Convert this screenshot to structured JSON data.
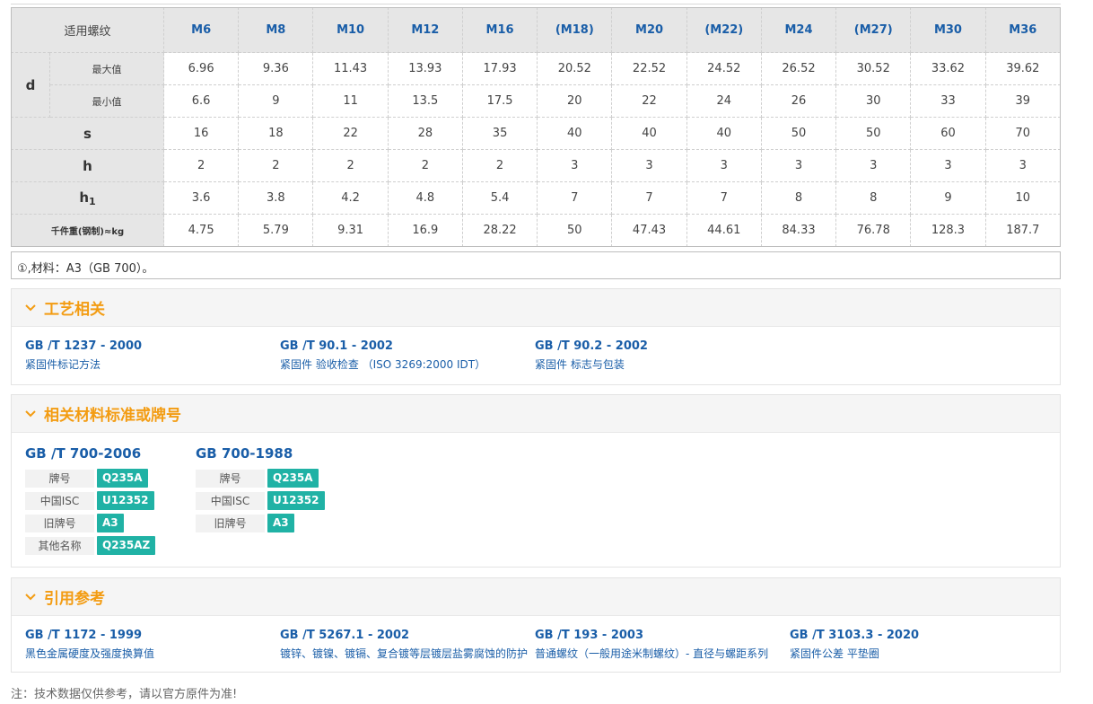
{
  "table": {
    "corner": "适用螺纹",
    "sizes": [
      "M6",
      "M8",
      "M10",
      "M12",
      "M16",
      "(M18)",
      "M20",
      "(M22)",
      "M24",
      "(M27)",
      "M30",
      "M36"
    ],
    "d_label": "d",
    "d_max_label": "最大值",
    "d_min_label": "最小值",
    "d_max": [
      "6.96",
      "9.36",
      "11.43",
      "13.93",
      "17.93",
      "20.52",
      "22.52",
      "24.52",
      "26.52",
      "30.52",
      "33.62",
      "39.62"
    ],
    "d_min": [
      "6.6",
      "9",
      "11",
      "13.5",
      "17.5",
      "20",
      "22",
      "24",
      "26",
      "30",
      "33",
      "39"
    ],
    "s_label": "s",
    "s": [
      "16",
      "18",
      "22",
      "28",
      "35",
      "40",
      "40",
      "40",
      "50",
      "50",
      "60",
      "70"
    ],
    "h_label": "h",
    "h": [
      "2",
      "2",
      "2",
      "2",
      "2",
      "3",
      "3",
      "3",
      "3",
      "3",
      "3",
      "3"
    ],
    "h1_label": "h",
    "h1_sub": "1",
    "h1": [
      "3.6",
      "3.8",
      "4.2",
      "4.8",
      "5.4",
      "7",
      "7",
      "7",
      "8",
      "8",
      "9",
      "10"
    ],
    "weight_label": "千件重(钢制)≈kg",
    "weight": [
      "4.75",
      "5.79",
      "9.31",
      "16.9",
      "28.22",
      "50",
      "47.43",
      "44.61",
      "84.33",
      "76.78",
      "128.3",
      "187.7"
    ]
  },
  "note": "①,材料：A3（GB 700）。",
  "process": {
    "title": "工艺相关",
    "items": [
      {
        "code": "GB /T 1237 - 2000",
        "desc": "紧固件标记方法"
      },
      {
        "code": "GB /T 90.1 - 2002",
        "desc": "紧固件 验收检查 （ISO 3269:2000 IDT）"
      },
      {
        "code": "GB /T 90.2 - 2002",
        "desc": "紧固件 标志与包装"
      }
    ]
  },
  "materials": {
    "title": "相关材料标准或牌号",
    "groups": [
      {
        "title": "GB /T 700-2006",
        "rows": [
          {
            "key": "牌号",
            "value": "Q235A"
          },
          {
            "key": "中国ISC",
            "value": "U12352"
          },
          {
            "key": "旧牌号",
            "value": "A3"
          },
          {
            "key": "其他名称",
            "value": "Q235AZ"
          }
        ]
      },
      {
        "title": "GB 700-1988",
        "rows": [
          {
            "key": "牌号",
            "value": "Q235A"
          },
          {
            "key": "中国ISC",
            "value": "U12352"
          },
          {
            "key": "旧牌号",
            "value": "A3"
          }
        ]
      }
    ]
  },
  "citations": {
    "title": "引用参考",
    "items": [
      {
        "code": "GB /T 1172 - 1999",
        "desc": "黑色金属硬度及强度换算值"
      },
      {
        "code": "GB /T 5267.1 - 2002",
        "desc": "镀锌、镀镍、镀镉、复合镀等层镀层盐雾腐蚀的防护"
      },
      {
        "code": "GB /T 193 - 2003",
        "desc": "普通螺纹（一般用途米制螺纹）- 直径与螺距系列"
      },
      {
        "code": "GB /T 3103.3 - 2020",
        "desc": "紧固件公差 平垫圈"
      }
    ]
  },
  "footnote": "注：技术数据仅供参考，请以官方原件为准!",
  "colors": {
    "accent": "#f39c12",
    "link": "#1a5ea8",
    "tag": "#20b2a5"
  },
  "icons": {
    "section_toggle": "chevron-down-icon"
  }
}
